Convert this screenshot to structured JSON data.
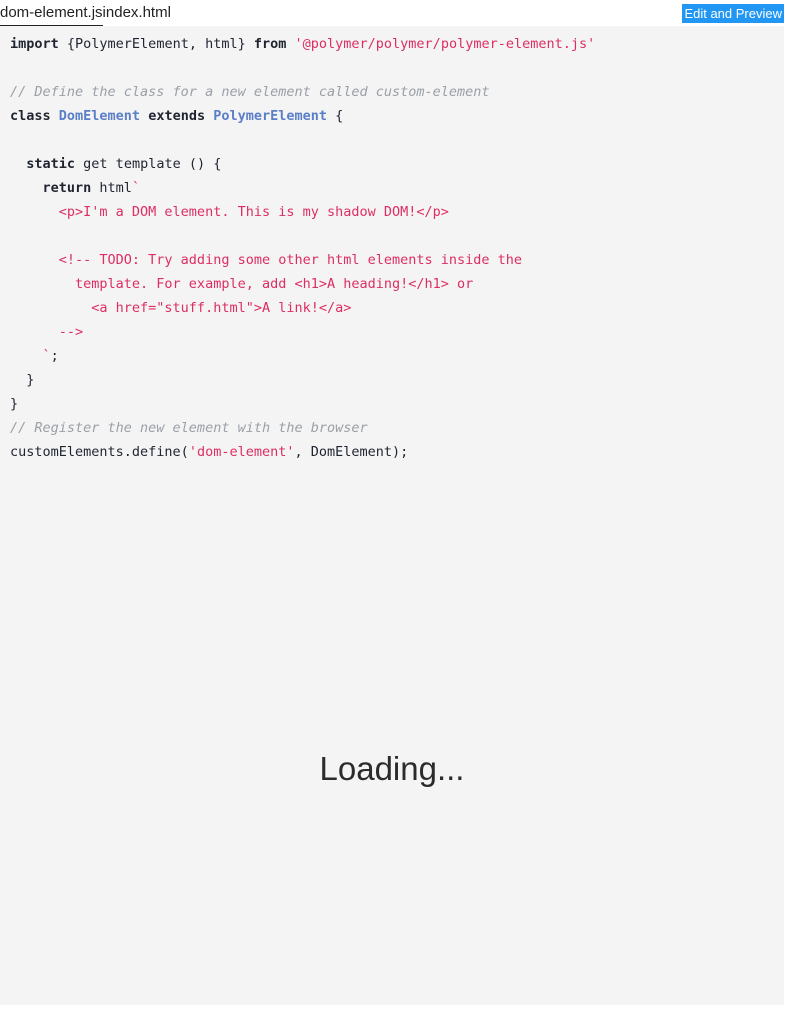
{
  "tabs": [
    {
      "label": "dom-element.js",
      "active": true
    },
    {
      "label": "index.html",
      "active": false
    }
  ],
  "mode_badge": {
    "label": "Edit and Preview",
    "color": "#2196f3",
    "text_color": "#ffffff"
  },
  "editor": {
    "language": "javascript",
    "background": "#f4f4f5",
    "colors": {
      "text": "#1f2430",
      "keyword": "#1f2430",
      "class": "#5b7fc7",
      "string": "#dd2e62",
      "template": "#dd2e62",
      "comment": "#9aa0a6"
    },
    "lines": [
      {
        "n": 1,
        "tokens": [
          {
            "t": "import",
            "k": "kw"
          },
          {
            "t": " {PolymerElement, html} ",
            "k": "plain"
          },
          {
            "t": "from",
            "k": "kw"
          },
          {
            "t": " ",
            "k": "plain"
          },
          {
            "t": "'@polymer/polymer/polymer-element.js'",
            "k": "str"
          }
        ]
      },
      {
        "n": 2,
        "tokens": []
      },
      {
        "n": 3,
        "tokens": [
          {
            "t": "// Define the class for a new element called custom-element",
            "k": "cmt"
          }
        ]
      },
      {
        "n": 4,
        "tokens": [
          {
            "t": "class",
            "k": "kw"
          },
          {
            "t": " ",
            "k": "plain"
          },
          {
            "t": "DomElement",
            "k": "cls"
          },
          {
            "t": " ",
            "k": "plain"
          },
          {
            "t": "extends",
            "k": "kw"
          },
          {
            "t": " ",
            "k": "plain"
          },
          {
            "t": "PolymerElement",
            "k": "cls"
          },
          {
            "t": " {",
            "k": "plain"
          }
        ]
      },
      {
        "n": 5,
        "tokens": []
      },
      {
        "n": 6,
        "tokens": [
          {
            "t": "  ",
            "k": "plain"
          },
          {
            "t": "static",
            "k": "kw"
          },
          {
            "t": " get template () {",
            "k": "plain"
          }
        ]
      },
      {
        "n": 7,
        "tokens": [
          {
            "t": "    ",
            "k": "plain"
          },
          {
            "t": "return",
            "k": "kw"
          },
          {
            "t": " html",
            "k": "plain"
          },
          {
            "t": "`",
            "k": "tmpl"
          }
        ]
      },
      {
        "n": 8,
        "tokens": [
          {
            "t": "      <p>I'm a DOM element. This is my shadow DOM!</p>",
            "k": "tmpl"
          }
        ]
      },
      {
        "n": 9,
        "tokens": []
      },
      {
        "n": 10,
        "tokens": [
          {
            "t": "      <!-- TODO: Try adding some other html elements inside the",
            "k": "tmpl"
          }
        ]
      },
      {
        "n": 11,
        "tokens": [
          {
            "t": "        template. For example, add <h1>A heading!</h1> or",
            "k": "tmpl"
          }
        ]
      },
      {
        "n": 12,
        "tokens": [
          {
            "t": "          <a href=\"stuff.html\">A link!</a>",
            "k": "tmpl"
          }
        ]
      },
      {
        "n": 13,
        "tokens": [
          {
            "t": "      -->",
            "k": "tmpl"
          }
        ]
      },
      {
        "n": 14,
        "tokens": [
          {
            "t": "    `",
            "k": "tmpl"
          },
          {
            "t": ";",
            "k": "plain"
          }
        ]
      },
      {
        "n": 15,
        "tokens": [
          {
            "t": "  }",
            "k": "plain"
          }
        ]
      },
      {
        "n": 16,
        "tokens": [
          {
            "t": "}",
            "k": "plain"
          }
        ]
      },
      {
        "n": 17,
        "tokens": [
          {
            "t": "// Register the new element with the browser",
            "k": "cmt"
          }
        ]
      },
      {
        "n": 18,
        "tokens": [
          {
            "t": "customElements.define(",
            "k": "plain"
          },
          {
            "t": "'dom-element'",
            "k": "str"
          },
          {
            "t": ", DomElement);",
            "k": "plain"
          }
        ]
      }
    ]
  },
  "preview": {
    "loading_text": "Loading..."
  }
}
